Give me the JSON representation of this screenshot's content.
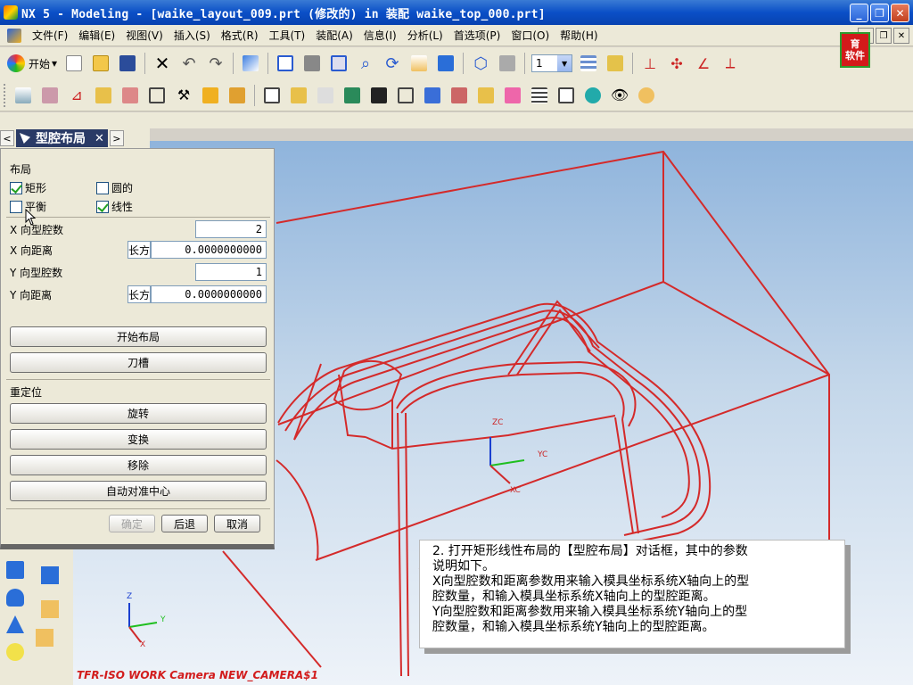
{
  "window": {
    "title": "NX 5 - Modeling - [waike_layout_009.prt  (修改的)   in 装配 waike_top_000.prt]",
    "minimize": "_",
    "restore": "❐",
    "close": "✕"
  },
  "menu": {
    "items": [
      "文件(F)",
      "编辑(E)",
      "视图(V)",
      "插入(S)",
      "格式(R)",
      "工具(T)",
      "装配(A)",
      "信息(I)",
      "分析(L)",
      "首选项(P)",
      "窗口(O)",
      "帮助(H)"
    ]
  },
  "logo": {
    "line1": "育",
    "line2": "菁",
    "line3": "软件"
  },
  "toolbar": {
    "start_label": "开始",
    "layer_value": "1"
  },
  "dialog": {
    "title": "型腔布局",
    "prev": "<",
    "next": ">",
    "close": "✕",
    "layout_group": "布局",
    "chk_rect": "矩形",
    "chk_circle": "圆的",
    "chk_balance": "平衡",
    "chk_linear": "线性",
    "x_count_label": "X 向型腔数",
    "x_count_value": "2",
    "x_dist_label": "X 向距离",
    "x_dist_unit": "长方",
    "x_dist_value": "0.0000000000",
    "y_count_label": "Y 向型腔数",
    "y_count_value": "1",
    "y_dist_label": "Y 向距离",
    "y_dist_unit": "长方",
    "y_dist_value": "0.0000000000",
    "btn_start_layout": "开始布局",
    "btn_slot": "刀槽",
    "reposition_group": "重定位",
    "btn_rotate": "旋转",
    "btn_transform": "变换",
    "btn_remove": "移除",
    "btn_auto_center": "自动对准中心",
    "btn_ok": "确定",
    "btn_back": "后退",
    "btn_cancel": "取消"
  },
  "callout": {
    "line1": "2. 打开矩形线性布局的【型腔布局】对话框，其中的参数",
    "line2": "说明如下。",
    "line3": "X向型腔数和距离参数用来输入模具坐标系统X轴向上的型",
    "line4": "腔数量，和输入模具坐标系统X轴向上的型腔距离。",
    "line5": "Y向型腔数和距离参数用来输入模具坐标系统Y轴向上的型",
    "line6": "腔数量，和输入模具坐标系统Y轴向上的型腔距离。"
  },
  "viewport": {
    "view_name": "TFR-ISO WORK Camera NEW_CAMERA$1",
    "axis_zc": "ZC",
    "axis_yc": "YC",
    "axis_xc": "XC",
    "axis_z": "Z",
    "axis_y": "Y",
    "axis_x": "X",
    "wire_color": "#d42a2a"
  }
}
